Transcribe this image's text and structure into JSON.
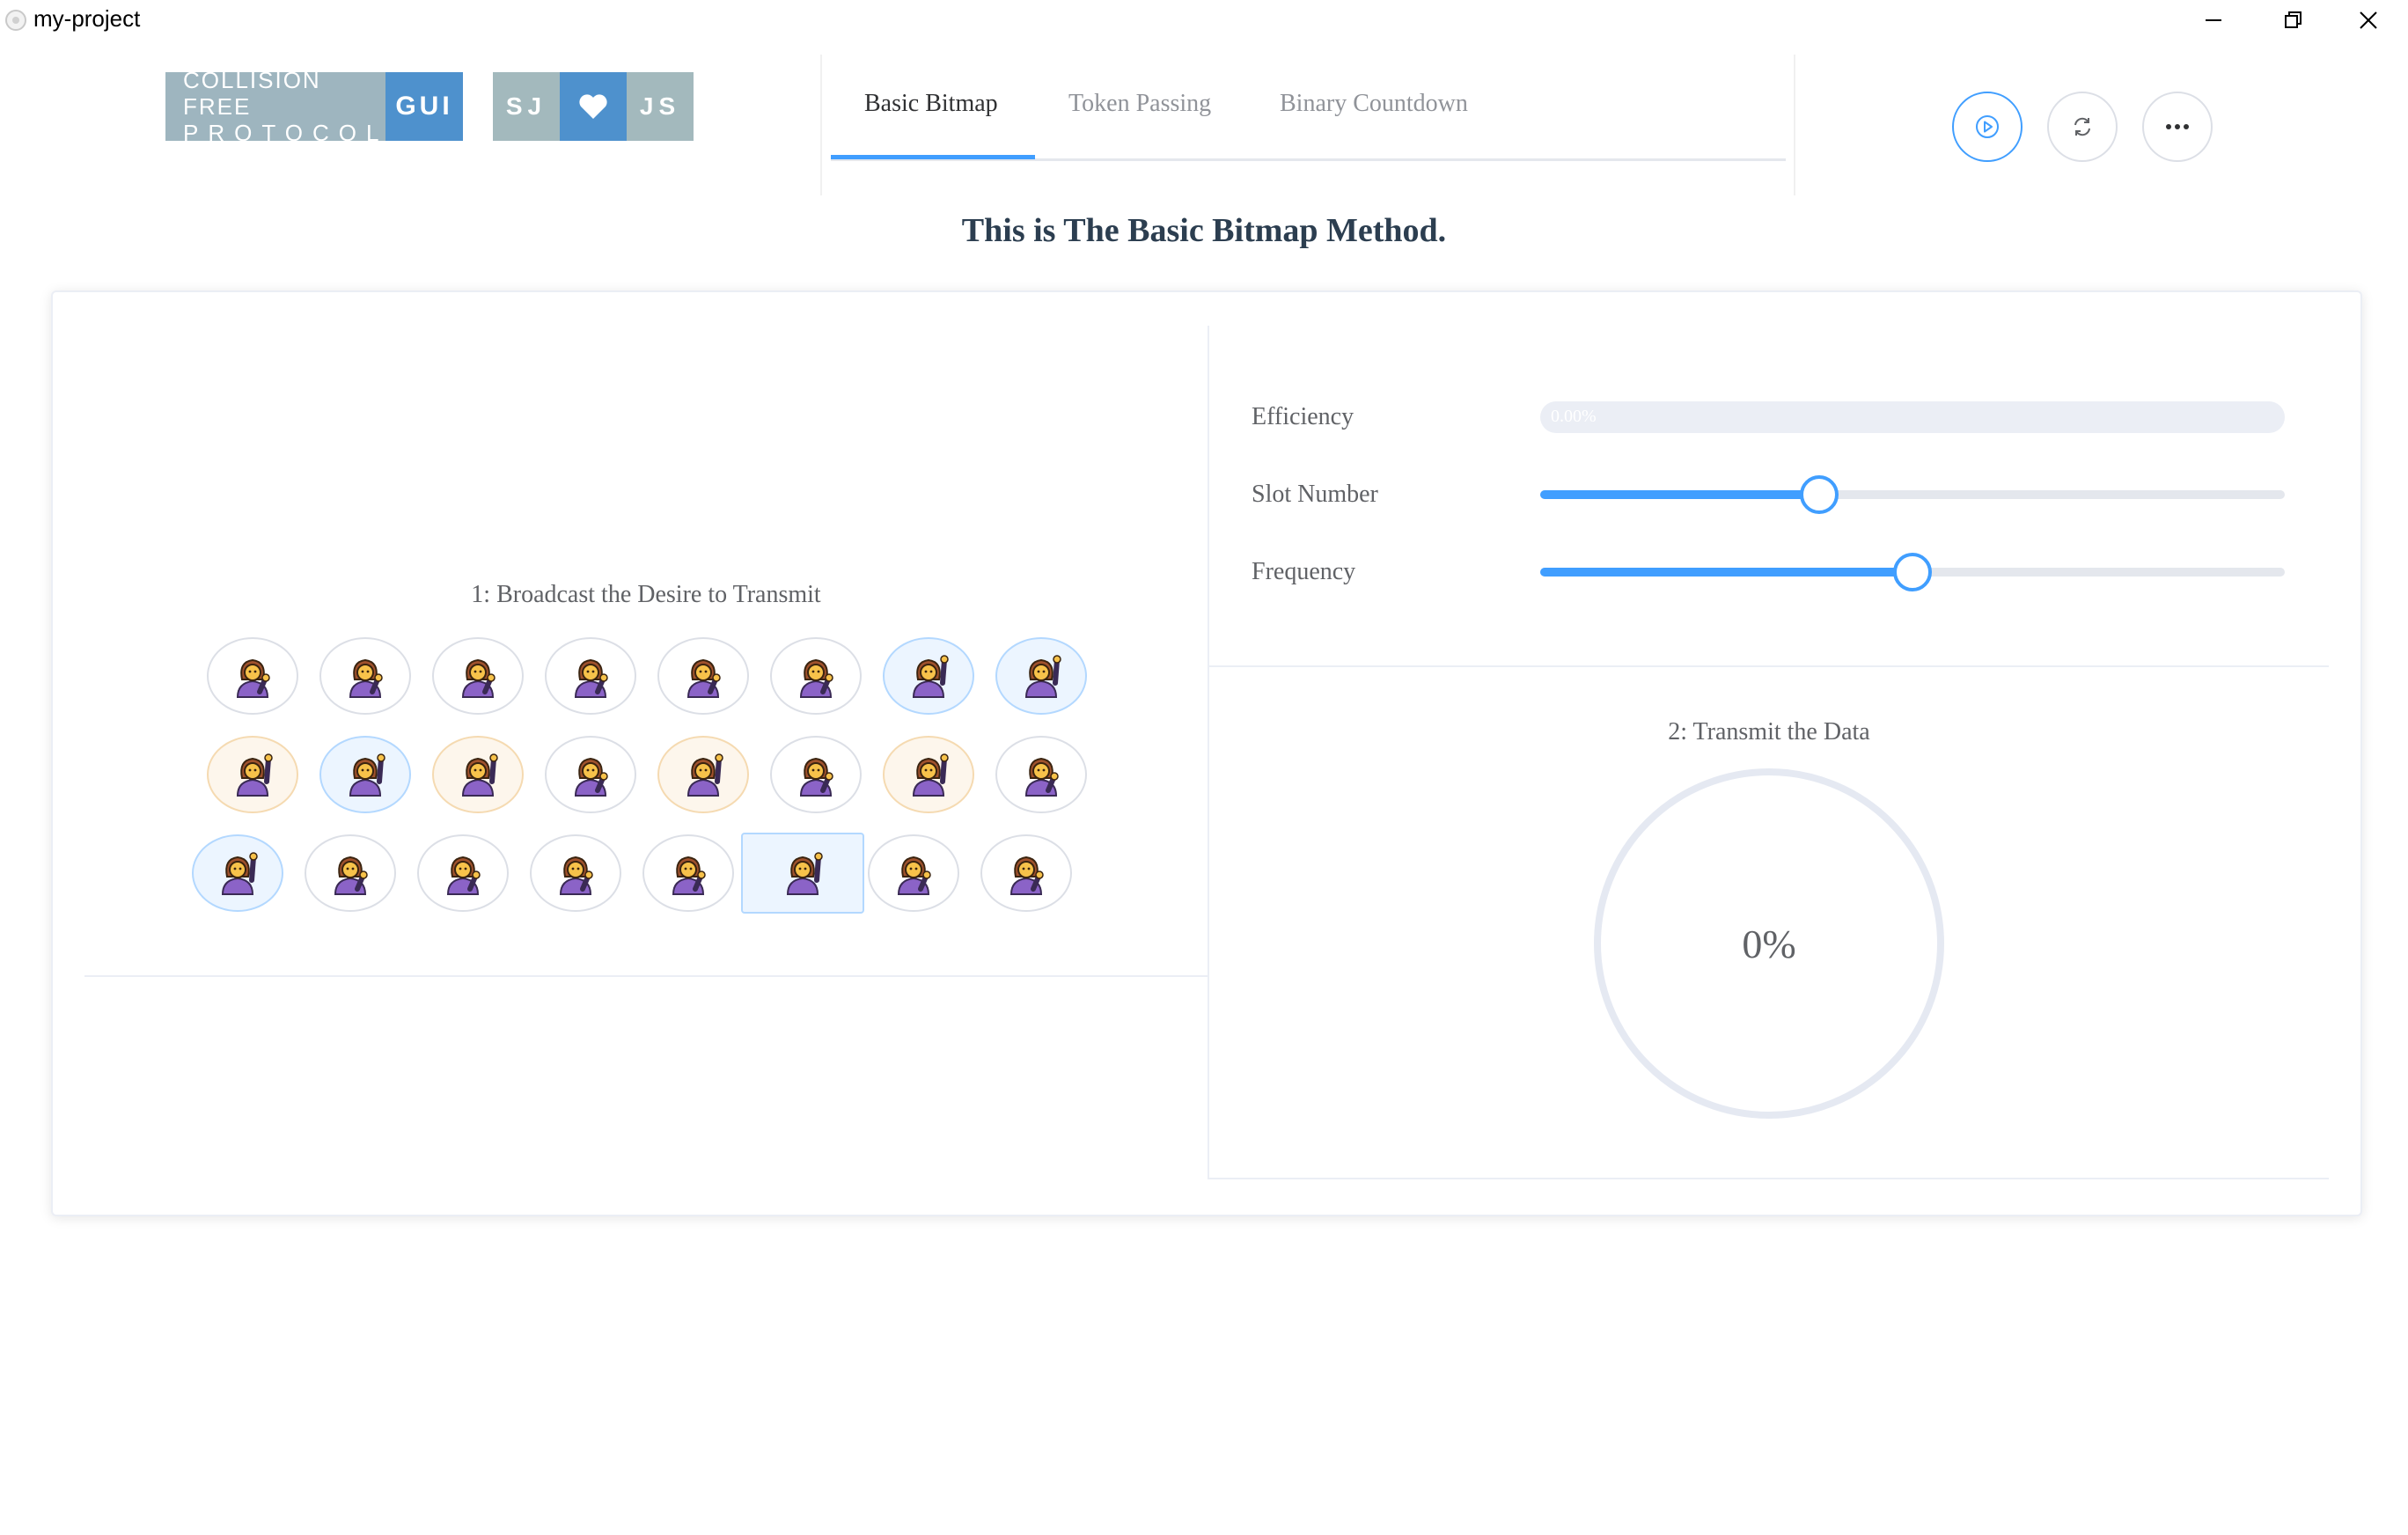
{
  "window": {
    "title": "my-project"
  },
  "badges": {
    "protocol": {
      "line1": "COLLISION FREE",
      "line2": "PROTOCOL",
      "tag": "GUI"
    },
    "author": {
      "left": "SJ",
      "right": "JS",
      "middle_icon": "heart-icon"
    }
  },
  "tabs": [
    {
      "label": "Basic Bitmap",
      "active": true
    },
    {
      "label": "Token Passing",
      "active": false
    },
    {
      "label": "Binary Countdown",
      "active": false
    }
  ],
  "actions": {
    "play_icon": "play-circle-icon",
    "refresh_icon": "refresh-icon",
    "more_icon": "more-icon"
  },
  "heading": "This is The Basic Bitmap Method.",
  "broadcast": {
    "label": "1: Broadcast the Desire to Transmit",
    "stations": [
      [
        "default",
        "default",
        "default",
        "default",
        "default",
        "default",
        "blue",
        "blue"
      ],
      [
        "orange",
        "blue",
        "orange",
        "default",
        "orange",
        "default",
        "orange",
        "default"
      ],
      [
        "blue",
        "default",
        "default",
        "default",
        "default",
        "rect",
        "default",
        "default"
      ]
    ],
    "raised_hand_states": [
      "blue",
      "orange",
      "rect"
    ]
  },
  "settings": {
    "efficiency": {
      "label": "Efficiency",
      "value_text": "0.00%",
      "percent": 0
    },
    "slot_number": {
      "label": "Slot Number",
      "fraction": 0.375
    },
    "frequency": {
      "label": "Frequency",
      "fraction": 0.5
    }
  },
  "transmit": {
    "label": "2: Transmit the Data",
    "progress_text": "0%",
    "percent": 0
  },
  "colors": {
    "accent": "#409eff",
    "track": "#e4e7ed",
    "badge_blue": "#4e91cd",
    "badge_gray": "#9eb5bf"
  }
}
